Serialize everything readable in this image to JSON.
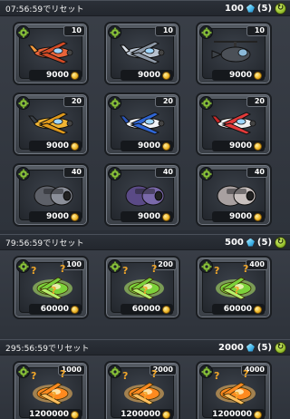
{
  "sections": [
    {
      "timer": "07:56:59でリセット",
      "gems": "100",
      "refresh": "(5)",
      "items": [
        {
          "level": "10",
          "price": "9000",
          "art": "orange-plane"
        },
        {
          "level": "10",
          "price": "9000",
          "art": "gray-jet"
        },
        {
          "level": "10",
          "price": "9000",
          "art": "helicopter"
        },
        {
          "level": "20",
          "price": "9000",
          "art": "yellow-plane"
        },
        {
          "level": "20",
          "price": "9000",
          "art": "blue-plane"
        },
        {
          "level": "20",
          "price": "9000",
          "art": "red-white-plane"
        },
        {
          "level": "40",
          "price": "9000",
          "art": "armored-pod"
        },
        {
          "level": "40",
          "price": "9000",
          "art": "purple-pod"
        },
        {
          "level": "40",
          "price": "9000",
          "art": "silver-pod"
        }
      ]
    },
    {
      "timer": "79:56:59でリセット",
      "gems": "500",
      "refresh": "(5)",
      "items": [
        {
          "level": "100",
          "price": "60000",
          "art": "green-mystery"
        },
        {
          "level": "200",
          "price": "60000",
          "art": "green-mystery"
        },
        {
          "level": "400",
          "price": "60000",
          "art": "green-mystery"
        }
      ]
    },
    {
      "timer": "295:56:59でリセット",
      "gems": "2000",
      "refresh": "(5)",
      "items": [
        {
          "level": "1000",
          "price": "1200000",
          "art": "orange-mystery"
        },
        {
          "level": "2000",
          "price": "1200000",
          "art": "orange-mystery"
        },
        {
          "level": "4000",
          "price": "1200000",
          "art": "orange-mystery"
        }
      ]
    }
  ],
  "colors": {
    "green_glow": "#9be34a",
    "orange_glow": "#ff9a2e",
    "coin": "#f0b92a",
    "gem": "#3fb3e8",
    "refresh": "#97c02c"
  },
  "icons": {
    "settings": "gear-icon",
    "currency": "coin-icon",
    "gem": "gem-icon",
    "refresh": "refresh-icon"
  }
}
